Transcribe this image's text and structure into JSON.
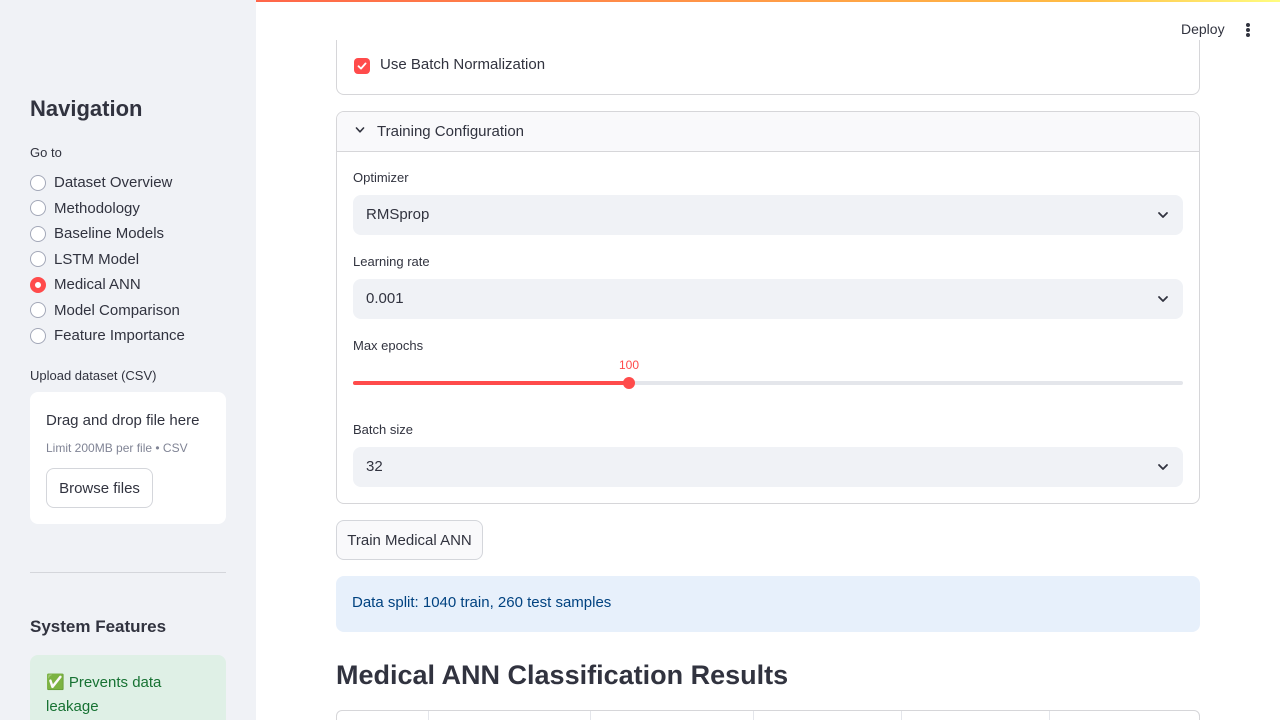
{
  "sidebar": {
    "nav_title": "Navigation",
    "goto_label": "Go to",
    "options": [
      {
        "label": "Dataset Overview",
        "selected": false
      },
      {
        "label": "Methodology",
        "selected": false
      },
      {
        "label": "Baseline Models",
        "selected": false
      },
      {
        "label": "LSTM Model",
        "selected": false
      },
      {
        "label": "Medical ANN",
        "selected": true
      },
      {
        "label": "Model Comparison",
        "selected": false
      },
      {
        "label": "Feature Importance",
        "selected": false
      }
    ],
    "upload_label": "Upload dataset (CSV)",
    "dropzone_title": "Drag and drop file here",
    "dropzone_limit": "Limit 200MB per file • CSV",
    "browse_label": "Browse files",
    "system_title": "System Features",
    "success_text": "✅ Prevents data leakage"
  },
  "header": {
    "deploy_label": "Deploy",
    "menu_icon": "kebab-menu-icon"
  },
  "main": {
    "batchnorm_label": "Use Batch Normalization",
    "batchnorm_checked": true,
    "expander_title": "Training Configuration",
    "optimizer_label": "Optimizer",
    "optimizer_value": "RMSprop",
    "lr_label": "Learning rate",
    "lr_value": "0.001",
    "epochs_label": "Max epochs",
    "epochs_value": "100",
    "epochs_fraction": 0.333,
    "batch_label": "Batch size",
    "batch_value": "32",
    "train_button": "Train Medical ANN",
    "info_text": "Data split: 1040 train, 260 test samples",
    "results_title": "Medical ANN Classification Results"
  },
  "colors": {
    "accent": "#ff4b4b",
    "sidebar_bg": "#f0f2f6",
    "info_bg": "#e7f0fb",
    "success_bg": "#dff0e6"
  }
}
